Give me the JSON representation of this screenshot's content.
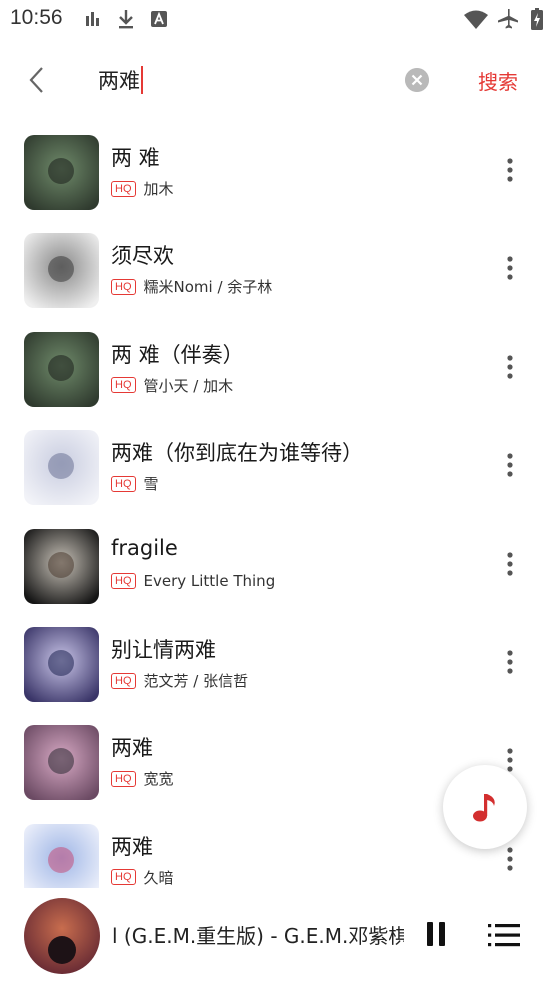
{
  "status_bar": {
    "time": "10:56",
    "icons": [
      "signal-bars-icon",
      "download-icon",
      "a-badge-icon",
      "wifi-icon",
      "airplane-icon",
      "battery-charging-icon"
    ]
  },
  "search": {
    "query": "两难",
    "submit_label": "搜索",
    "accent_color": "#e53935"
  },
  "results": [
    {
      "title": "两 难",
      "quality": "HQ",
      "artist": "加木",
      "cover_colors": [
        "#2f3a2e",
        "#6f8a6a",
        "#1b1f1b"
      ]
    },
    {
      "title": "须尽欢",
      "quality": "HQ",
      "artist": "糯米Nomi / 余子林",
      "cover_colors": [
        "#efefef",
        "#8a8a8a",
        "#3a3a3a"
      ]
    },
    {
      "title": "两 难（伴奏）",
      "quality": "HQ",
      "artist": "管小天 / 加木",
      "cover_colors": [
        "#2f3a2e",
        "#6f8a6a",
        "#1b1f1b"
      ]
    },
    {
      "title": "两难（你到底在为谁等待）",
      "quality": "HQ",
      "artist": "雪",
      "cover_colors": [
        "#f2f3f8",
        "#c9cde0",
        "#6c7396"
      ]
    },
    {
      "title": "fragile",
      "quality": "HQ",
      "artist": "Every Little Thing",
      "cover_colors": [
        "#151515",
        "#c8c2b8",
        "#4a3a30"
      ]
    },
    {
      "title": "别让情两难",
      "quality": "HQ",
      "artist": "范文芳 / 张信哲",
      "cover_colors": [
        "#3a3568",
        "#c9c5e8",
        "#1e2350"
      ]
    },
    {
      "title": "两难",
      "quality": "HQ",
      "artist": "宽宽",
      "cover_colors": [
        "#6b4a63",
        "#d7a9c4",
        "#2b2a33"
      ]
    },
    {
      "title": "两难",
      "quality": "HQ",
      "artist": "久暗",
      "cover_colors": [
        "#eef1fb",
        "#9fb6e6",
        "#c44f7a"
      ]
    }
  ],
  "player": {
    "now_playing": "l (G.E.M.重生版) - G.E.M.邓紫棋",
    "cover_colors": [
      "#5a2130",
      "#c86d4e",
      "#1d1216"
    ]
  }
}
